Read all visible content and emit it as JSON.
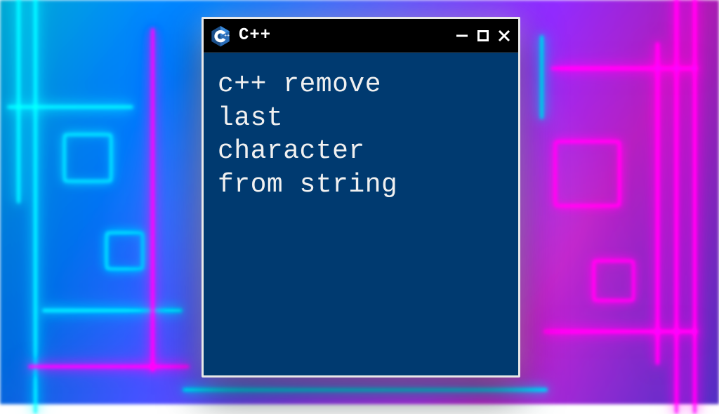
{
  "window": {
    "title": "C++",
    "icon": "cpp-logo",
    "controls": {
      "minimize": "−",
      "maximize": "□",
      "close": "×"
    }
  },
  "content": {
    "text": "c++ remove\nlast\ncharacter\nfrom string"
  },
  "colors": {
    "window_bg": "#000000",
    "body_bg": "#003a70",
    "text": "#f0f0f0",
    "border": "#e8e8e8"
  }
}
